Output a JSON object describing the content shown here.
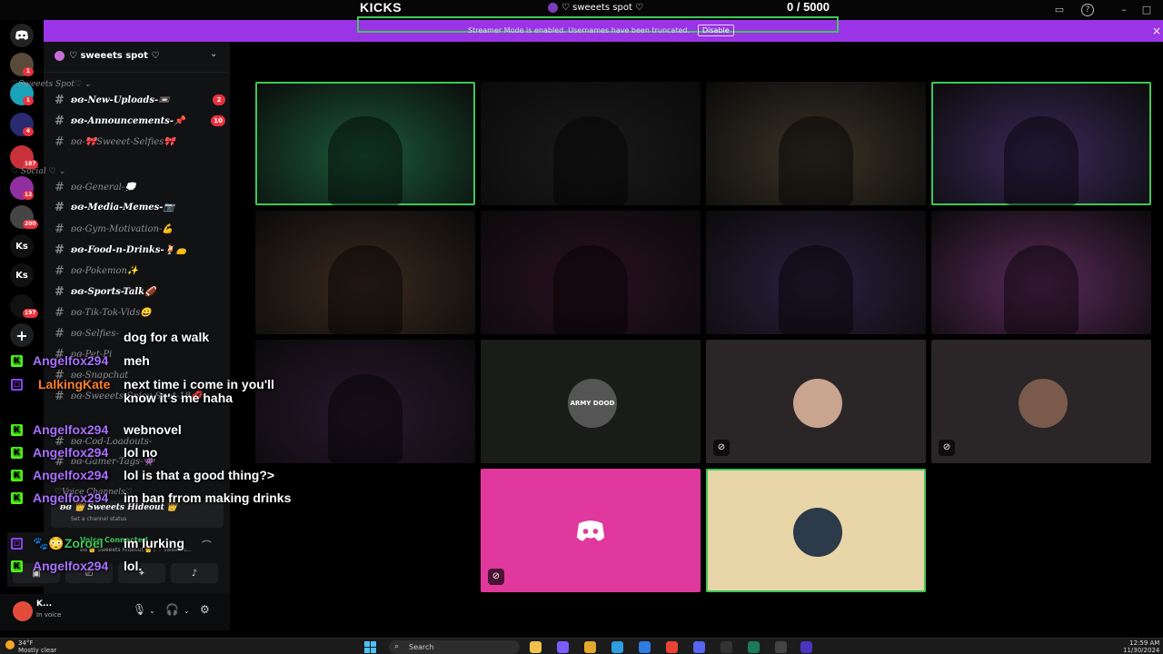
{
  "topbar": {
    "stream_title": "KICKS",
    "server_name": "♡ sweeets spot ♡",
    "counter": "0   / 5000"
  },
  "banner": {
    "text": "Streamer Mode is enabled. Usernames have been truncated.",
    "disable_label": "Disable",
    "close": "×"
  },
  "rail": {
    "servers": [
      {
        "label": "",
        "badge": "1"
      },
      {
        "label": "",
        "badge": "1"
      },
      {
        "label": "",
        "badge": "4"
      },
      {
        "label": "",
        "badge": "187"
      },
      {
        "label": "",
        "badge": "12"
      },
      {
        "label": "",
        "badge": "200"
      },
      {
        "label": "Ks",
        "badge": ""
      },
      {
        "label": "Ks",
        "badge": ""
      },
      {
        "label": "",
        "badge": "197"
      }
    ],
    "add_label": "+"
  },
  "sidebar": {
    "server_name": "♡ sweeets spot ♡",
    "categories": [
      "♡Sweeets Spot♡ ⌄",
      "♡ Social ♡ ⌄",
      "♡Voice Channels♡"
    ],
    "channels": [
      {
        "name": "ʚɞ-New-Uploads-📼",
        "unread": true,
        "badge": "2"
      },
      {
        "name": "ʚɞ-Announcements-📌",
        "unread": true,
        "badge": "10"
      },
      {
        "name": "ʚɞ-🎀Sweeet-Selfies🎀",
        "unread": false,
        "badge": ""
      },
      {
        "name": "ʚɞ-General-💭",
        "unread": false,
        "badge": ""
      },
      {
        "name": "ʚɞ-Media-Memes-📷",
        "unread": true,
        "badge": ""
      },
      {
        "name": "ʚɞ-Gym-Motivation-💪",
        "unread": false,
        "badge": ""
      },
      {
        "name": "ʚɞ-Food-n-Drinks-🍹👝",
        "unread": true,
        "badge": ""
      },
      {
        "name": "ʚɞ-Pokemon✨",
        "unread": false,
        "badge": ""
      },
      {
        "name": "ʚɞ-Sports-Talk🏈",
        "unread": true,
        "badge": ""
      },
      {
        "name": "ʚɞ-Tik-Tok-Vids😀",
        "unread": false,
        "badge": ""
      },
      {
        "name": "ʚɞ-Selfies-",
        "unread": false,
        "badge": ""
      },
      {
        "name": "ʚɞ-Pet-Pi",
        "unread": false,
        "badge": ""
      },
      {
        "name": "ʚɞ-Snapchat",
        "unread": false,
        "badge": ""
      },
      {
        "name": "ʚɞ-Sweeets-Spicy-Spot-18💋",
        "unread": false,
        "badge": ""
      },
      {
        "name": "ʚɞ-Cod-Loadouts-",
        "unread": false,
        "badge": ""
      },
      {
        "name": "ʚɞ-Gamer-Tags-👾",
        "unread": false,
        "badge": ""
      }
    ],
    "voice_channel": {
      "name": "ʚɞ 👑 Sweeets Hideout 👑",
      "status": "Set a channel status"
    },
    "voice_connected": {
      "label": "Voice Connected",
      "location": "ʚɞ 👑 Sweeets Hideout 👑 / ♡ sweeets..."
    },
    "user": {
      "name": "K...",
      "status": "In voice"
    }
  },
  "chat": [
    {
      "platform": "none",
      "user": "",
      "color": "#a970ff",
      "text": "dog for a walk"
    },
    {
      "platform": "kick",
      "user": "Angelfox294",
      "color": "#a970ff",
      "text": "meh"
    },
    {
      "platform": "twitch",
      "user": "LalkingKate",
      "color": "#ff7f27",
      "text": "next time i come in you'll know it's me haha"
    },
    {
      "platform": "kick",
      "user": "Angelfox294",
      "color": "#a970ff",
      "text": "webnovel"
    },
    {
      "platform": "kick",
      "user": "Angelfox294",
      "color": "#a970ff",
      "text": "lol no"
    },
    {
      "platform": "kick",
      "user": "Angelfox294",
      "color": "#a970ff",
      "text": "lol is that a good thing?>"
    },
    {
      "platform": "kick",
      "user": "Angelfox294",
      "color": "#a970ff",
      "text": "im ban frrom making drinks"
    },
    {
      "platform": "twitch",
      "user": "🐾😳Zoroel",
      "color": "#3ec85a",
      "text": "im lurking"
    },
    {
      "platform": "kick",
      "user": "Angelfox294",
      "color": "#a970ff",
      "text": "lol."
    }
  ],
  "video_tiles": [
    {
      "kind": "video",
      "speaking": true,
      "bg": "#1c5a3a",
      "muted": false
    },
    {
      "kind": "video",
      "speaking": false,
      "bg": "#1a1a1a",
      "muted": false
    },
    {
      "kind": "video",
      "speaking": false,
      "bg": "#3a3426",
      "muted": false
    },
    {
      "kind": "video",
      "speaking": true,
      "bg": "#3a2a5a",
      "muted": false
    },
    {
      "kind": "video",
      "speaking": false,
      "bg": "#3b2a1e",
      "muted": false
    },
    {
      "kind": "video",
      "speaking": false,
      "bg": "#2a1020",
      "muted": false
    },
    {
      "kind": "video",
      "speaking": false,
      "bg": "#2c2140",
      "muted": false
    },
    {
      "kind": "video",
      "speaking": false,
      "bg": "#5a2a5a",
      "muted": false
    },
    {
      "kind": "video",
      "speaking": false,
      "bg": "#2a1830",
      "muted": false
    },
    {
      "kind": "avatar",
      "speaking": false,
      "bg": "#1a1c1a",
      "muted": false,
      "avatar_color": "#555",
      "avatar_label": "ARMY DOOD"
    },
    {
      "kind": "avatar",
      "speaking": false,
      "bg": "#2a2527",
      "muted": true,
      "avatar_color": "#c9a48f",
      "avatar_label": ""
    },
    {
      "kind": "avatar",
      "speaking": false,
      "bg": "#2a2527",
      "muted": true,
      "avatar_color": "#7a5a4a",
      "avatar_label": ""
    },
    {
      "kind": "discord",
      "speaking": false,
      "bg": "#e0389c",
      "muted": true
    },
    {
      "kind": "avatar",
      "speaking": true,
      "bg": "#e8d6a8",
      "muted": false,
      "avatar_color": "#2b3b4a",
      "avatar_label": ""
    }
  ],
  "taskbar": {
    "weather_temp": "34°F",
    "weather_desc": "Mostly clear",
    "search_label": "Search",
    "time": "12:59 AM",
    "date": "11/30/2024"
  },
  "colors": {
    "banner": "#9b33e6",
    "speaking": "#3ec85a",
    "kick": "#53fc18",
    "twitch": "#9146ff"
  }
}
